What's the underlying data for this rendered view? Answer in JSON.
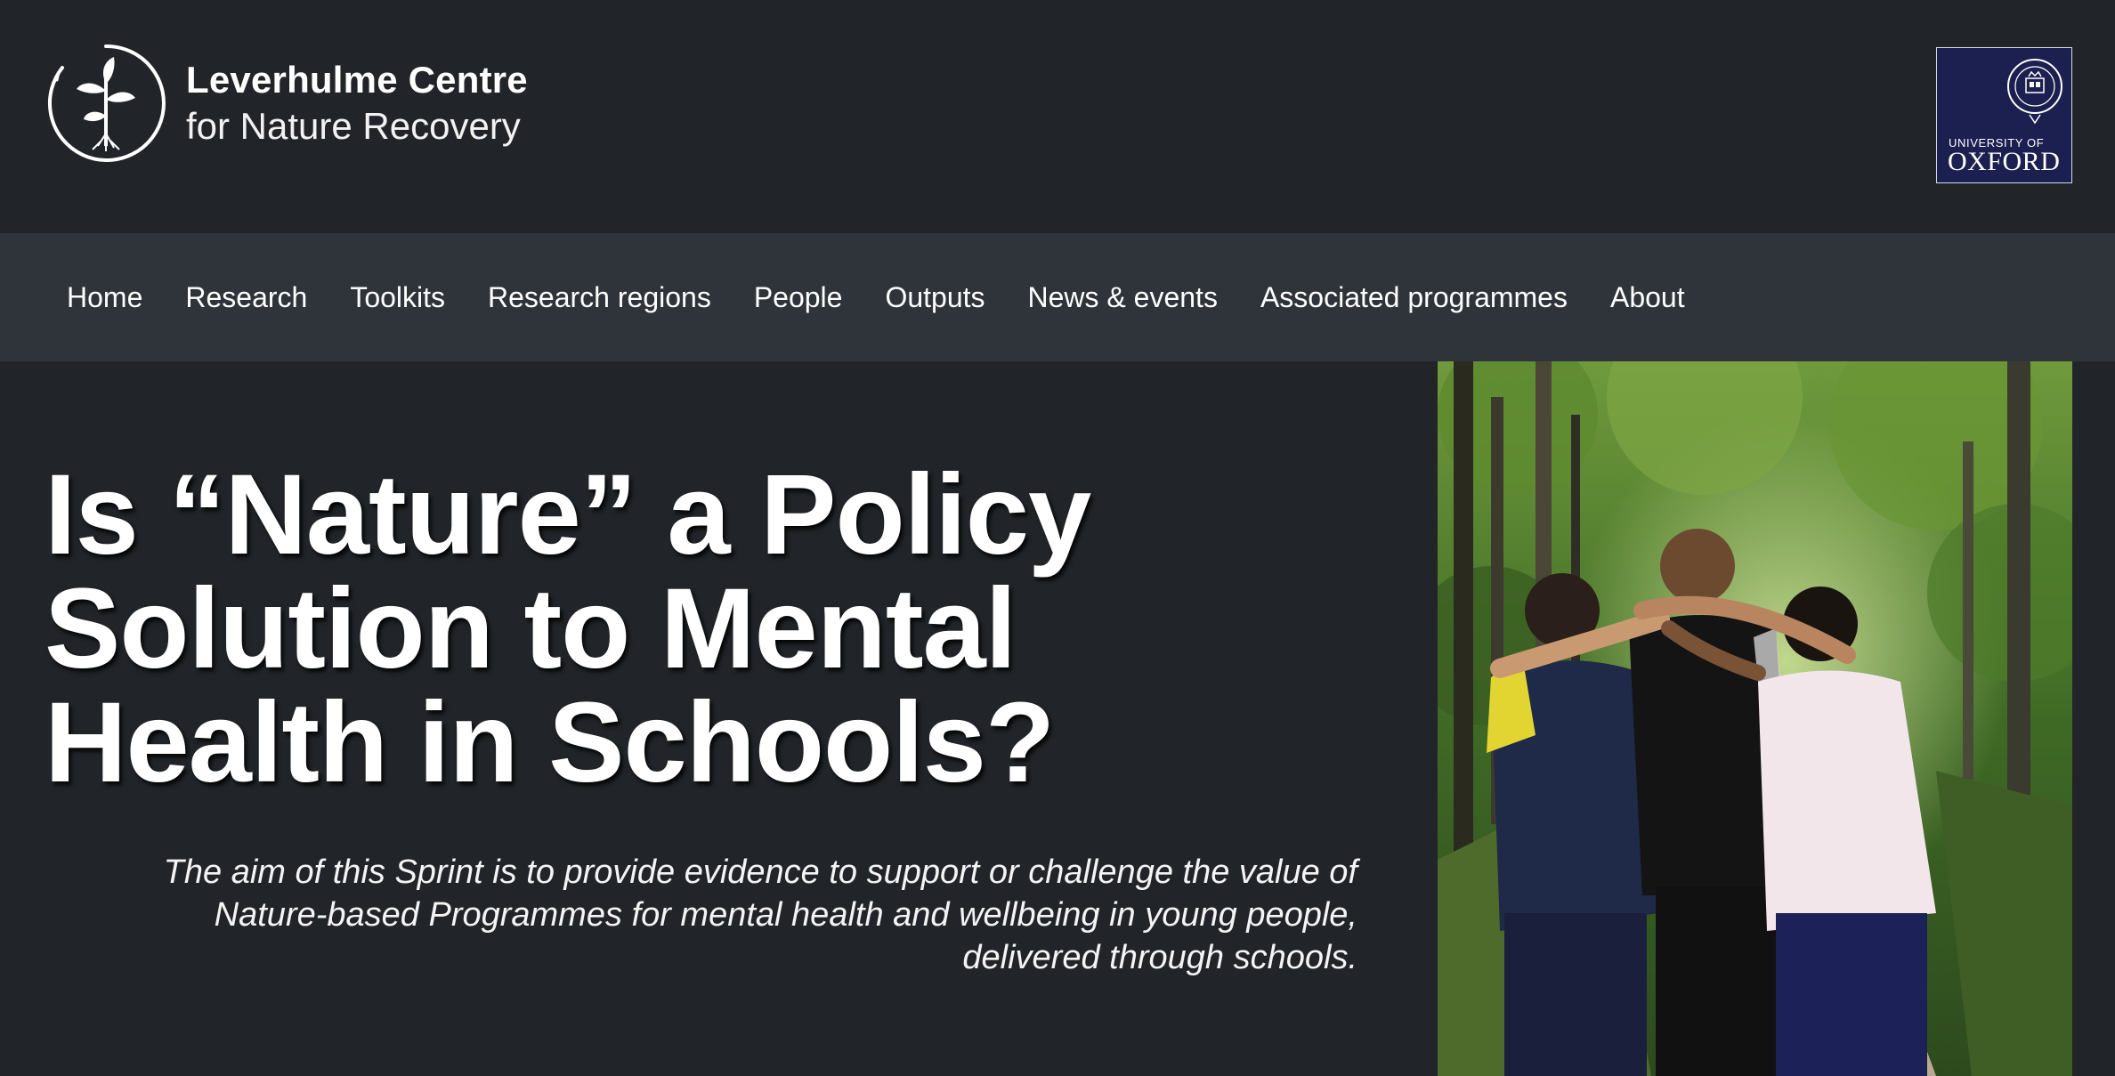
{
  "header": {
    "brand_line1": "Leverhulme Centre",
    "brand_line2": "for Nature Recovery",
    "logo_icon": "sprouting-plant-circle-icon",
    "partner_logo": {
      "line1": "UNIVERSITY OF",
      "line2": "OXFORD",
      "crest_icon": "oxford-crest-icon"
    }
  },
  "nav": {
    "items": [
      {
        "label": "Home"
      },
      {
        "label": "Research"
      },
      {
        "label": "Toolkits"
      },
      {
        "label": "Research regions"
      },
      {
        "label": "People"
      },
      {
        "label": "Outputs"
      },
      {
        "label": "News & events"
      },
      {
        "label": "Associated programmes"
      },
      {
        "label": "About"
      }
    ]
  },
  "hero": {
    "title": "Is “Nature” a Policy Solution to Mental Health in Schools?",
    "subtitle": "The aim of this Sprint is to provide evidence to support or challenge the value of Nature-based Programmes for mental health and wellbeing in young people, delivered through schools.",
    "photo": "children-walking-in-woodland-photo"
  },
  "colors": {
    "page_background": "#212529",
    "nav_background": "#2e3439",
    "oxford_blue": "#1c2050",
    "text": "#ffffff"
  }
}
